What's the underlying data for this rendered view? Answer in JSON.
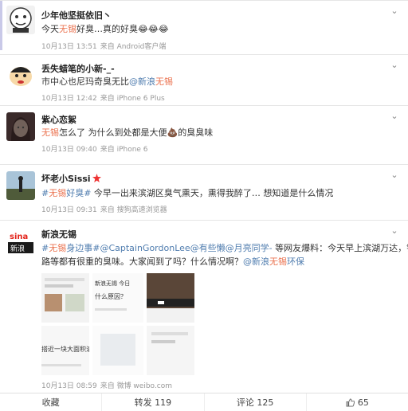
{
  "posts": [
    {
      "name": "少年他坚挺依旧丶",
      "text_pre": "今天",
      "text_hl": "无锡",
      "text_post": "好臭…真的好臭",
      "emoji": "😂😂😂",
      "time": "10月13日 13:51",
      "source": "来自 Android客户端"
    },
    {
      "name": "丢失蜡笔的小新-_-",
      "text_pre": "市中心也尼玛奇臭无比",
      "link": "@新浪",
      "link_hl": "无锡",
      "time": "10月13日 12:42",
      "source": "来自 iPhone 6 Plus"
    },
    {
      "name": "紫心恋絮",
      "text_hl": "无锡",
      "text_pre": "怎么了 为什么到处都是大便",
      "text_post": "的臭臭味",
      "time": "10月13日 09:40",
      "source": "来自 iPhone 6"
    },
    {
      "name": "坏老小Sissi",
      "tag_pre": "#",
      "tag_hl": "无锡",
      "tag_post": "好臭#",
      "text": " 今早一出来滨湖区臭气熏天，熏得我醉了… 想知道是什么情况",
      "time": "10月13日 09:31",
      "source": "来自 搜狗高速浏览器"
    },
    {
      "name": "新浪无锡",
      "tag_pre": "#",
      "tag_hl": "无锡",
      "tag_post": "身边事#",
      "mention1": "@CaptainGordonLee",
      "mention2": "@有些懒",
      "mention3": "@月亮同学-",
      "text1": " 等网友爆料：今天早上滨湖万达，钱荣",
      "text2": "路等都有很重的臭味。大家闻到了吗？什么情况啊？",
      "mention4": "@新浪",
      "mention4_hl": "无锡",
      "mention4_post": "环保",
      "img_cap1": "新浪无锡 今日",
      "img_cap2": "什么原因？",
      "img_cap3": "搭近一块大面积滚",
      "time": "10月13日 08:59",
      "source": "来自 微博 weibo.com"
    }
  ],
  "actions": {
    "favorite": "收藏",
    "repost": "转发 119",
    "comment": "评论 125",
    "like": "65"
  },
  "colors": {
    "highlight": "#eb7350",
    "link": "#507daf"
  }
}
